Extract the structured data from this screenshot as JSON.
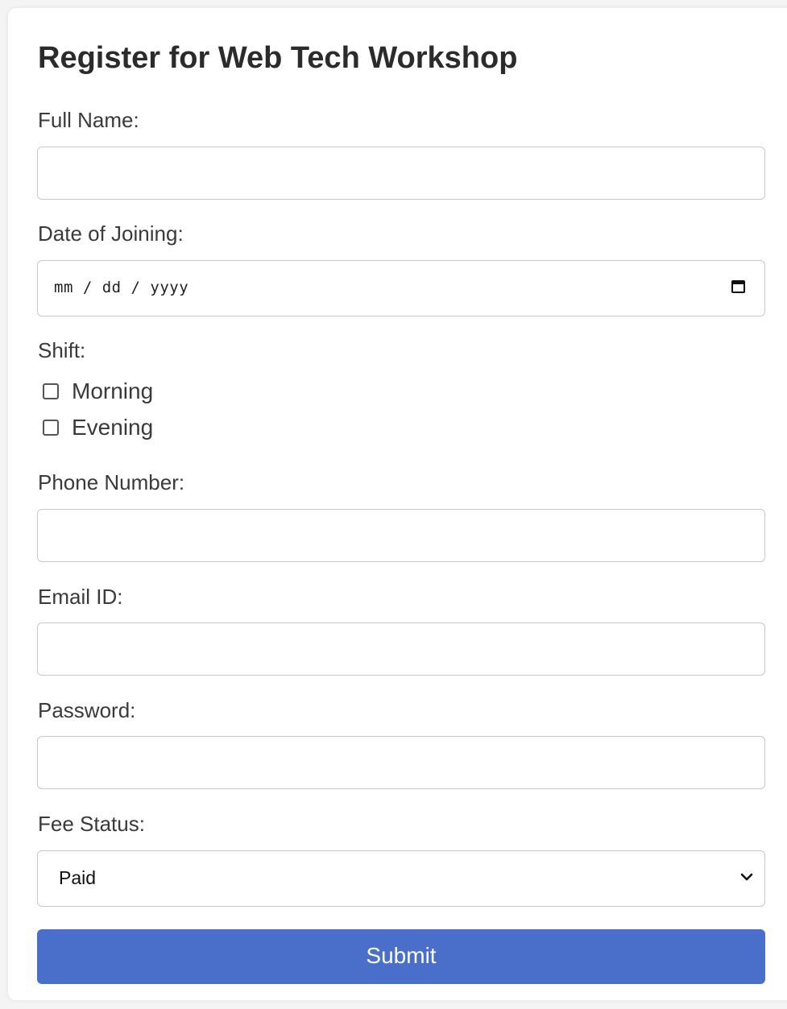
{
  "form": {
    "title": "Register for Web Tech Workshop",
    "full_name": {
      "label": "Full Name:",
      "value": ""
    },
    "date_of_joining": {
      "label": "Date of Joining:",
      "placeholder": "mm / dd / yyyy",
      "icon": "calendar-icon"
    },
    "shift": {
      "label": "Shift:",
      "options": [
        {
          "label": "Morning",
          "checked": false
        },
        {
          "label": "Evening",
          "checked": false
        }
      ]
    },
    "phone_number": {
      "label": "Phone Number:",
      "value": ""
    },
    "email_id": {
      "label": "Email ID:",
      "value": ""
    },
    "password": {
      "label": "Password:",
      "value": ""
    },
    "fee_status": {
      "label": "Fee Status:",
      "selected": "Paid",
      "icon": "chevron-down-icon"
    },
    "submit_label": "Submit"
  },
  "colors": {
    "accent": "#4a6fcb",
    "page_background": "#f4f4f4",
    "card_background": "#ffffff"
  }
}
